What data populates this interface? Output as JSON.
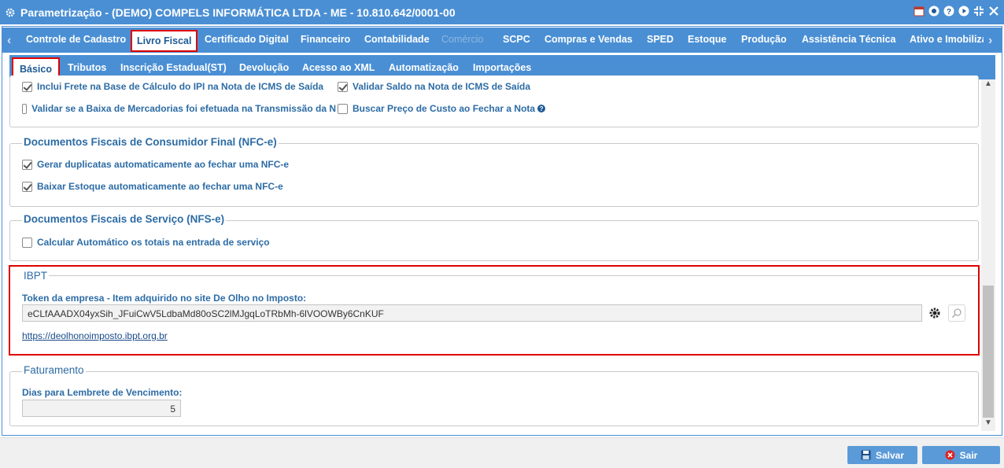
{
  "window": {
    "title": "Parametrização - (DEMO) COMPELS INFORMÁTICA LTDA - ME - 10.810.642/0001-00",
    "controls": [
      "calendar-icon",
      "chat-icon",
      "help-icon",
      "play-icon",
      "expand-icon",
      "close-icon"
    ]
  },
  "main_tabs": [
    {
      "label": "Controle de Cadastro"
    },
    {
      "label": "Livro Fiscal",
      "active": true
    },
    {
      "label": "Certificado Digital"
    },
    {
      "label": "Financeiro"
    },
    {
      "label": "Contabilidade"
    },
    {
      "label": "Comércio",
      "disabled": true
    },
    {
      "label": "SCPC"
    },
    {
      "label": "Compras e Vendas"
    },
    {
      "label": "SPED"
    },
    {
      "label": "Estoque"
    },
    {
      "label": "Produção"
    },
    {
      "label": "Assistência Técnica"
    },
    {
      "label": "Ativo e Imobilizado"
    }
  ],
  "sub_tabs": [
    {
      "label": "Básico",
      "active": true
    },
    {
      "label": "Tributos"
    },
    {
      "label": "Inscrição Estadual(ST)"
    },
    {
      "label": "Devolução"
    },
    {
      "label": "Acesso ao XML"
    },
    {
      "label": "Automatização"
    },
    {
      "label": "Importações"
    }
  ],
  "top_section": {
    "options": [
      {
        "label": "Inclui Frete na Base de Cálculo do IPI na Nota de ICMS de Saída",
        "checked": true
      },
      {
        "label": "Validar Saldo na Nota de ICMS de Saída",
        "checked": true
      },
      {
        "label": "Validar se a Baixa de Mercadorias foi efetuada na Transmissão da N",
        "checked": false
      },
      {
        "label": "Buscar Preço de Custo ao Fechar a Nota",
        "checked": false,
        "help": true
      }
    ]
  },
  "nfce": {
    "legend": "Documentos Fiscais de Consumidor Final (NFC-e)",
    "options": [
      {
        "label": "Gerar duplicatas automaticamente ao fechar uma NFC-e",
        "checked": true
      },
      {
        "label": "Baixar Estoque automaticamente ao fechar uma NFC-e",
        "checked": true
      }
    ]
  },
  "nfse": {
    "legend": "Documentos Fiscais de Serviço (NFS-e)",
    "options": [
      {
        "label": "Calcular Automático os totais na entrada de serviço",
        "checked": false
      }
    ]
  },
  "ibpt": {
    "legend": "IBPT",
    "token_label": "Token da empresa - Item adquirido no site De Olho no Imposto:",
    "token_value": "eCLfAAADX04yxSih_JFuiCwV5LdbaMd80oSC2lMJgqLoTRbMh-6lVOOWBy6CnKUF",
    "link": "https://deolhonoimposto.ibpt.org.br"
  },
  "faturamento": {
    "legend": "Faturamento",
    "days_label": "Dias para Lembrete de Vencimento:",
    "days_value": "5"
  },
  "footer": {
    "save_label": "Salvar",
    "exit_label": "Sair"
  },
  "colors": {
    "accent": "#4a8fd4",
    "highlight": "#e00000",
    "label": "#2d6ca5"
  }
}
